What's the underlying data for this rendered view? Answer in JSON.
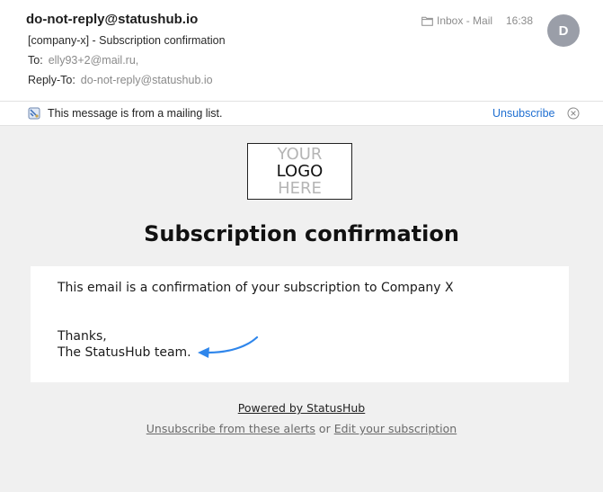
{
  "header": {
    "from": "do-not-reply@statushub.io",
    "subject": "[company-x] - Subscription confirmation",
    "to_label": "To:",
    "to_value": "elly93+2@mail.ru,",
    "reply_to_label": "Reply-To:",
    "reply_to_value": "do-not-reply@statushub.io",
    "mailbox": "Inbox - Mail",
    "mailbox_icon": "folder-icon",
    "time": "16:38",
    "avatar_initial": "D"
  },
  "banner": {
    "icon": "mailing-list-icon",
    "text": "This message is from a mailing list.",
    "unsubscribe_label": "Unsubscribe",
    "close_icon": "close-circle-icon"
  },
  "email": {
    "logo": {
      "line1": "YOUR",
      "line2": "LOGO",
      "line3": "HERE"
    },
    "title": "Subscription confirmation",
    "body": "This email is a confirmation of your subscription to Company X",
    "signoff_line1": "Thanks,",
    "signoff_line2": "The StatusHub team.",
    "annotation_color": "#2f86eb"
  },
  "footer": {
    "powered_by": "Powered by StatusHub",
    "unsubscribe_alerts": "Unsubscribe from these alerts",
    "or": "or",
    "edit_subscription": "Edit your subscription"
  }
}
